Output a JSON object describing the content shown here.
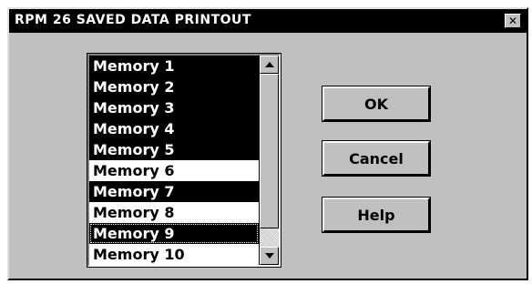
{
  "window": {
    "title": "RPM 26 SAVED DATA PRINTOUT",
    "close_glyph": "✕"
  },
  "list": {
    "items": [
      {
        "label": "Memory 1",
        "selected": true
      },
      {
        "label": "Memory 2",
        "selected": true
      },
      {
        "label": "Memory 3",
        "selected": true
      },
      {
        "label": "Memory 4",
        "selected": true
      },
      {
        "label": "Memory 5",
        "selected": true
      },
      {
        "label": "Memory 6",
        "selected": false
      },
      {
        "label": "Memory 7",
        "selected": true
      },
      {
        "label": "Memory 8",
        "selected": false
      },
      {
        "label": "Memory 9",
        "selected": true,
        "focused": true
      },
      {
        "label": "Memory 10",
        "selected": false
      }
    ]
  },
  "buttons": {
    "ok": "OK",
    "cancel": "Cancel",
    "help": "Help"
  },
  "icons": {
    "scroll_up": "up-arrow-icon",
    "scroll_down": "down-arrow-icon",
    "close": "close-icon"
  }
}
